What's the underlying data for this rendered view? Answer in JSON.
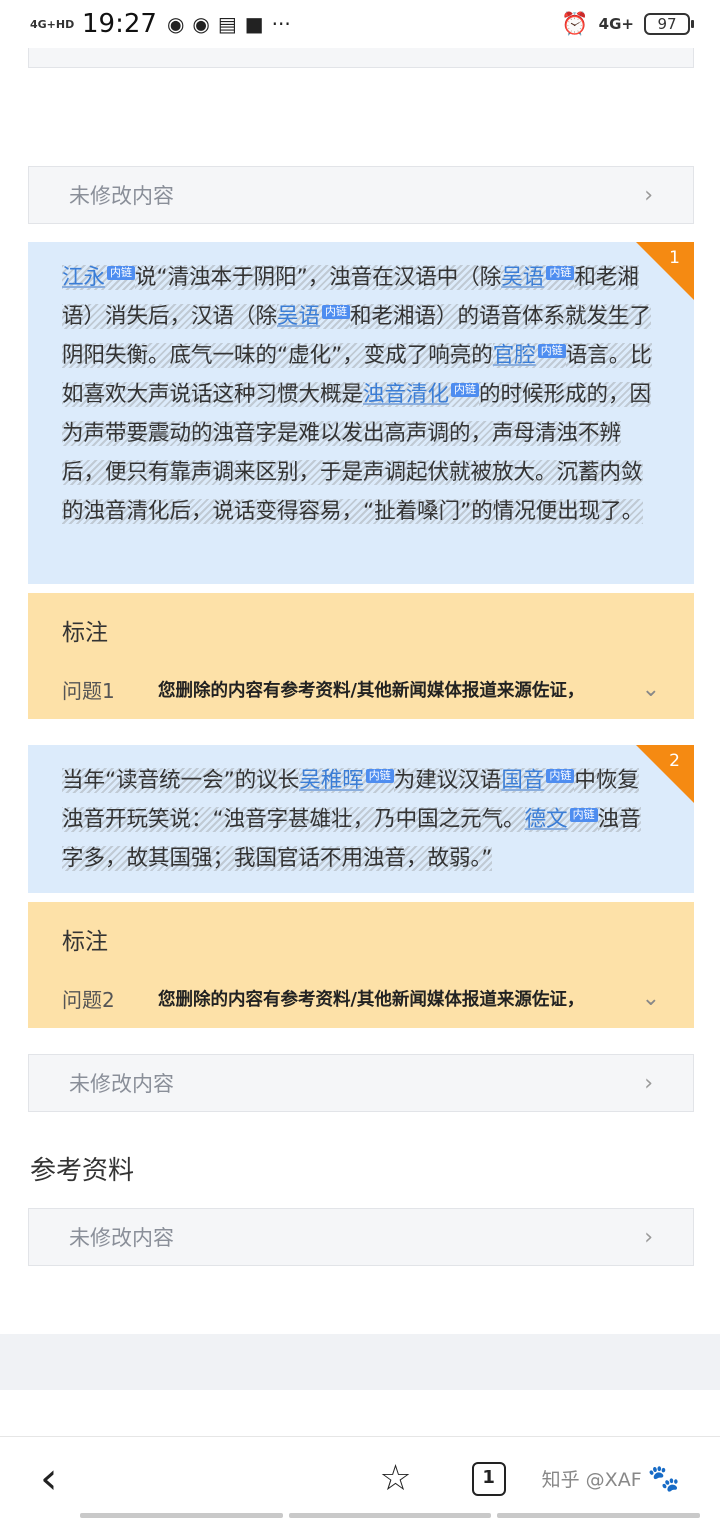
{
  "status": {
    "network": "4G+HD",
    "time": "19:27",
    "battery": "97",
    "right_net": "4G+"
  },
  "cards": {
    "unmodified": "未修改内容"
  },
  "block1": {
    "number": "1",
    "links": {
      "jiangyong": "江永",
      "wuyu": "吴语",
      "wuyu2": "吴语",
      "guanqiang": "官腔",
      "zhuoyin": "浊音清化"
    },
    "tag": "内链",
    "t1": "说“清浊本于阴阳”，浊音在汉语中（除",
    "t2": "和老湘语）消失后，汉语（除",
    "t3": "和老湘语）的语音体系就发生了阴阳失衡。底气一味的“虚化”，变成了响亮的",
    "t4": "语言。比如喜欢大声说话这种习惯大概是",
    "t5": "的时候形成的，因为声带要震动的浊音字是难以发出高声调的，声母清浊不辨后，便只有靠声调来区别，于是声调起伏就被放大。沉蓄内敛的浊音清化后，说话变得容易，“扯着嗓门”的情况便出现了。"
  },
  "note1": {
    "title": "标注",
    "question": "问题1",
    "text": "您删除的内容有参考资料/其他新闻媒体报道来源佐证，"
  },
  "block2": {
    "number": "2",
    "links": {
      "wuzhihui": "吴稚晖",
      "guoyin": "国音",
      "dewen": "德文"
    },
    "tag": "内链",
    "t1": "当年“读音统一会”的议长",
    "t2": "为建议汉语",
    "t3": "中恢复浊音开玩笑说：“浊音字甚雄壮，乃中国之元气。",
    "t4": "浊音字多，故其国强；我国官话不用浊音，故弱。”"
  },
  "note2": {
    "title": "标注",
    "question": "问题2",
    "text": "您删除的内容有参考资料/其他新闻媒体报道来源佐证，"
  },
  "references": {
    "title": "参考资料"
  },
  "nav": {
    "tabs_count": "1",
    "watermark": "知乎 @XAF"
  }
}
